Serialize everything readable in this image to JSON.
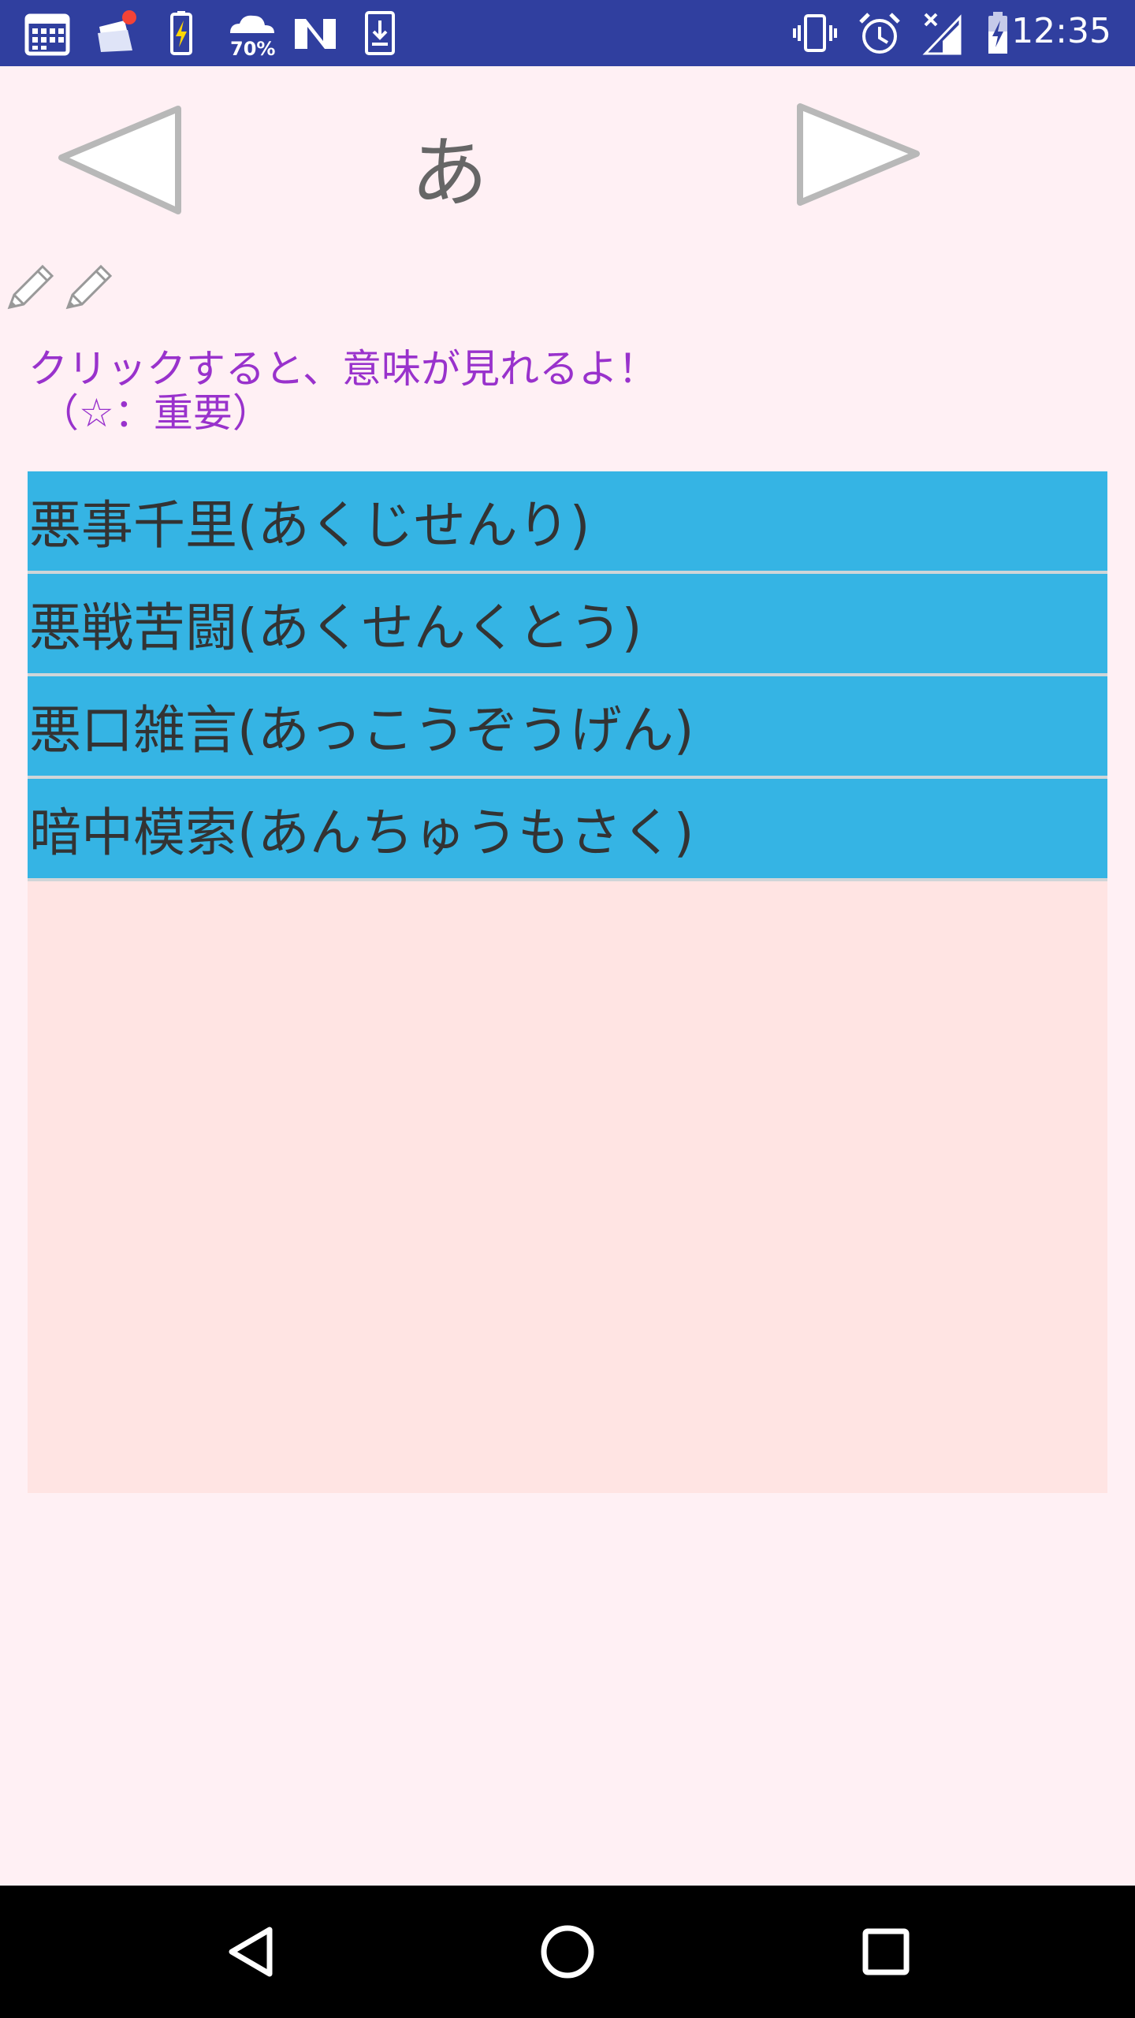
{
  "status_bar": {
    "time": "12:35",
    "weather_percent": "70%",
    "left_icons": [
      "calendar-icon",
      "files-notification-icon",
      "battery-charging-icon",
      "weather-icon",
      "n-app-icon",
      "download-icon"
    ],
    "right_icons": [
      "vibrate-icon",
      "alarm-icon",
      "no-signal-icon",
      "battery-icon"
    ]
  },
  "header": {
    "kana": "あ",
    "prev_icon": "triangle-left-icon",
    "next_icon": "triangle-right-icon"
  },
  "tools": [
    "pencil-icon",
    "pencil-icon"
  ],
  "hint": {
    "line1": "クリックすると、意味が見れるよ！",
    "line2": "（☆：重要）"
  },
  "list": {
    "items": [
      {
        "label": "悪事千里(あくじせんり)"
      },
      {
        "label": "悪戦苦闘(あくせんくとう)"
      },
      {
        "label": "悪口雑言(あっこうぞうげん)"
      },
      {
        "label": "暗中模索(あんちゅうもさく)"
      }
    ]
  },
  "colors": {
    "status_bar": "#303f9f",
    "background": "#fff0f4",
    "list_panel": "#ffe4e3",
    "list_item": "#35b4e4",
    "hint_text": "#9932cc",
    "nav_bar": "#000000"
  },
  "nav_bar": {
    "buttons": [
      "back-icon",
      "home-icon",
      "recents-icon"
    ]
  }
}
